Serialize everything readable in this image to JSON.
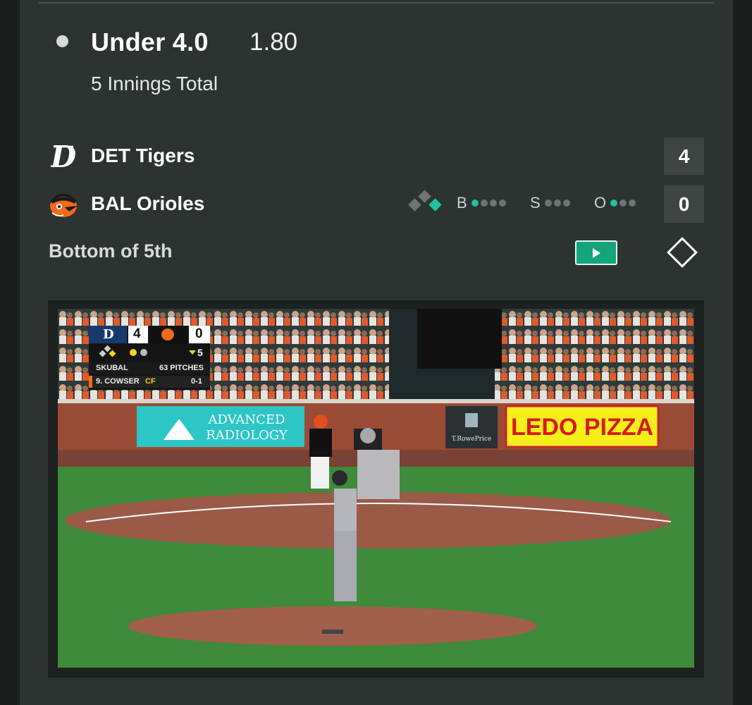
{
  "selection": {
    "name": "Under 4.0",
    "odds": "1.80",
    "market": "5 Innings Total"
  },
  "teams": [
    {
      "name": "DET Tigers",
      "score": "4",
      "logo": "tigers-logo"
    },
    {
      "name": "BAL Orioles",
      "score": "0",
      "logo": "orioles-logo"
    }
  ],
  "count": {
    "balls_label": "B",
    "balls": 1,
    "strikes_label": "S",
    "strikes": 0,
    "outs_label": "O",
    "outs": 1
  },
  "bases_occupied": {
    "first": true,
    "second": false,
    "third": false
  },
  "inning": "Bottom of 5th",
  "colors": {
    "accent": "#1fc39d",
    "play_button": "#13a57c",
    "card": "#2d3330",
    "orioles": "#f26a1b"
  },
  "video": {
    "bug": {
      "away_abbr": "D",
      "away_score": "4",
      "home_score": "0",
      "inning_num": "5",
      "pitcher": "SKUBAL",
      "pitch_count": "63 PITCHES",
      "batter": "9. COWSER",
      "batter_pos": "CF",
      "batter_count": "0-1"
    },
    "signs": {
      "advanced_line1": "ADVANCED",
      "advanced_line2": "RADIOLOGY",
      "trowe": "T.RowePrice",
      "ledo": "LEDO PIZZA"
    }
  }
}
